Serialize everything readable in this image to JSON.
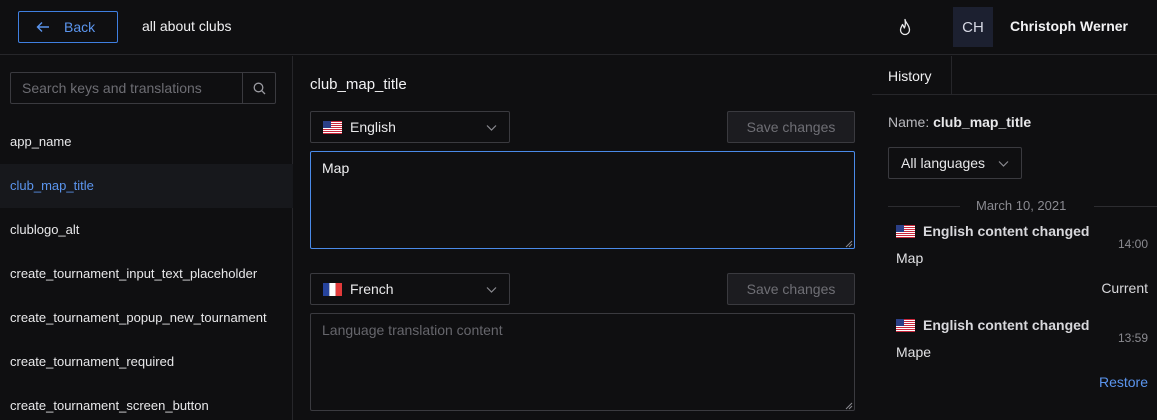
{
  "header": {
    "back_label": "Back",
    "project_name": "all about clubs",
    "avatar_initials": "CH",
    "user_name": "Christoph Werner"
  },
  "sidebar": {
    "search_placeholder": "Search keys and translations",
    "keys": [
      {
        "label": "app_name",
        "active": false
      },
      {
        "label": "club_map_title",
        "active": true
      },
      {
        "label": "clublogo_alt",
        "active": false
      },
      {
        "label": "create_tournament_input_text_placeholder",
        "active": false
      },
      {
        "label": "create_tournament_popup_new_tournament",
        "active": false
      },
      {
        "label": "create_tournament_required",
        "active": false
      },
      {
        "label": "create_tournament_screen_button",
        "active": false
      }
    ]
  },
  "editor": {
    "key_title": "club_map_title",
    "languages": [
      {
        "name": "English",
        "flag": "us-flag-icon",
        "save_label": "Save changes",
        "value": "Map",
        "placeholder": ""
      },
      {
        "name": "French",
        "flag": "fr-flag-icon",
        "save_label": "Save changes",
        "value": "",
        "placeholder": "Language translation content"
      }
    ]
  },
  "history": {
    "tab_label": "History",
    "name_prefix": "Name:",
    "name_value": "club_map_title",
    "filter_label": "All languages",
    "date": "March 10, 2021",
    "events": [
      {
        "title": "English content changed",
        "time": "14:00",
        "content": "Map",
        "action": "Current"
      },
      {
        "title": "English content changed",
        "time": "13:59",
        "content": "Mape",
        "action": "Restore"
      }
    ]
  },
  "colors": {
    "background": "#0f0f11",
    "accent": "#5b95ee",
    "border": "#3a3a3f"
  }
}
